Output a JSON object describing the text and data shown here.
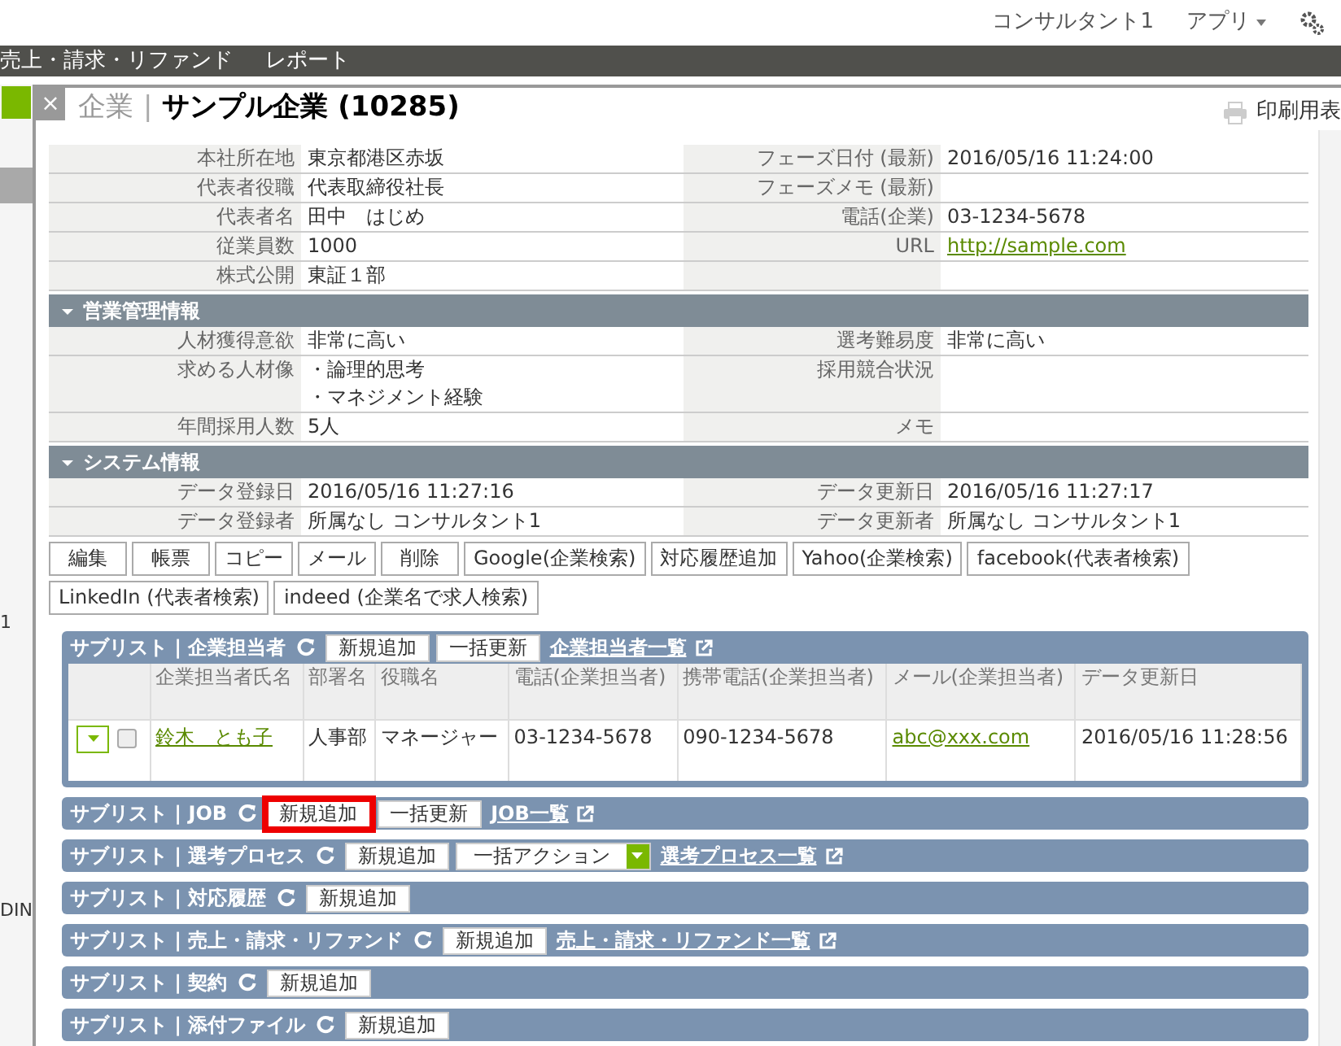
{
  "top_bar": {
    "user": "コンサルタント1",
    "apps_menu": "アプリ"
  },
  "nav": {
    "items": [
      "売上・請求・リファンド",
      "レポート"
    ]
  },
  "background_list": {
    "texts": [
      "1",
      "DIN"
    ]
  },
  "dialog": {
    "close": "×",
    "category": "企業",
    "separator": "|",
    "title": "サンプル企業 (10285)",
    "print_link": "印刷用表",
    "detail_rows": [
      {
        "label": "本社所在地",
        "value": "東京都港区赤坂",
        "label2": "フェーズ日付 (最新)",
        "value2": "2016/05/16 11:24:00"
      },
      {
        "label": "代表者役職",
        "value": "代表取締役社長",
        "label2": "フェーズメモ (最新)"
      },
      {
        "label": "代表者名",
        "value": "田中　はじめ",
        "label2": "電話(企業)",
        "value2": "03-1234-5678"
      },
      {
        "label": "従業員数",
        "value": "1000",
        "label2": "URL",
        "link2": "http://sample.com"
      },
      {
        "label": "株式公開",
        "value": "東証１部"
      }
    ],
    "sections": [
      {
        "title": "営業管理情報",
        "expanded": true,
        "rows": [
          {
            "label": "人材獲得意欲",
            "value": "非常に高い",
            "label2": "選考難易度",
            "value2": "非常に高い"
          },
          {
            "label": "求める人材像",
            "lines": [
              "・論理的思考",
              "・マネジメント経験"
            ],
            "label2": "採用競合状況"
          },
          {
            "label": "年間採用人数",
            "value": "5人",
            "label2": "メモ"
          }
        ]
      },
      {
        "title": "システム情報",
        "expanded": true,
        "rows": [
          {
            "label": "データ登録日",
            "value": "2016/05/16 11:27:16",
            "label2": "データ更新日",
            "value2": "2016/05/16 11:27:17"
          },
          {
            "label": "データ登録者",
            "value": "所属なし コンサルタント1",
            "label2": "データ更新者",
            "value2": "所属なし コンサルタント1"
          }
        ]
      }
    ],
    "actions": [
      "編集",
      "帳票",
      "コピー",
      "メール",
      "削除",
      "Google(企業検索)",
      "対応履歴追加",
      "Yahoo(企業検索)",
      "facebook(代表者検索)",
      "LinkedIn (代表者検索)",
      "indeed (企業名で求人検索)"
    ],
    "sublists": [
      {
        "title": "サブリスト | 企業担当者",
        "buttons": [
          {
            "label": "新規追加",
            "highlighted": false
          },
          {
            "label": "一括更新",
            "highlighted": false
          }
        ],
        "link": "企業担当者一覧",
        "table": {
          "columns": [
            "企業担当者氏名",
            "部署名",
            "役職名",
            "電話(企業担当者)",
            "携帯電話(企業担当者)",
            "メール(企業担当者)",
            "データ更新日"
          ],
          "rows": [
            {
              "checked": false,
              "cells": [
                {
                  "text": "鈴木　とも子",
                  "kind": "link"
                },
                {
                  "text": "人事部",
                  "kind": "text"
                },
                {
                  "text": "マネージャー",
                  "kind": "text"
                },
                {
                  "text": "03-1234-5678",
                  "kind": "text"
                },
                {
                  "text": "090-1234-5678",
                  "kind": "text"
                },
                {
                  "text": "abc@xxx.com",
                  "kind": "link"
                },
                {
                  "text": "2016/05/16 11:28:56",
                  "kind": "text"
                }
              ]
            }
          ]
        }
      },
      {
        "title": "サブリスト | JOB",
        "buttons": [
          {
            "label": "新規追加",
            "highlighted": true
          },
          {
            "label": "一括更新",
            "highlighted": false
          }
        ],
        "link": "JOB一覧"
      },
      {
        "title": "サブリスト | 選考プロセス",
        "buttons": [
          {
            "label": "新規追加",
            "highlighted": false
          }
        ],
        "select": "一括アクション",
        "link": "選考プロセス一覧"
      },
      {
        "title": "サブリスト | 対応履歴",
        "buttons": [
          {
            "label": "新規追加",
            "highlighted": false
          }
        ]
      },
      {
        "title": "サブリスト | 売上・請求・リファンド",
        "buttons": [
          {
            "label": "新規追加",
            "highlighted": false
          }
        ],
        "link": "売上・請求・リファンド一覧"
      },
      {
        "title": "サブリスト | 契約",
        "buttons": [
          {
            "label": "新規追加",
            "highlighted": false
          }
        ]
      },
      {
        "title": "サブリスト | 添付ファイル",
        "buttons": [
          {
            "label": "新規追加",
            "highlighted": false
          }
        ]
      }
    ]
  }
}
